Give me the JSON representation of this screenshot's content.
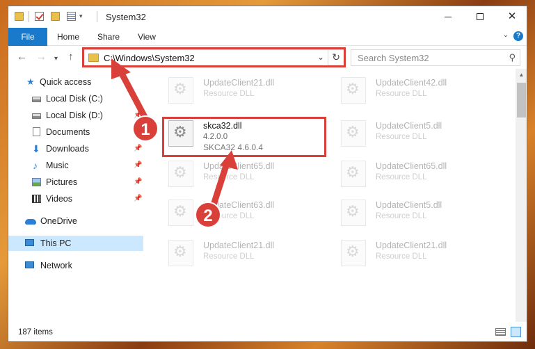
{
  "window": {
    "title": "System32",
    "minimize_glyph": "",
    "maximize_glyph": "",
    "close_glyph": "✕"
  },
  "ribbon": {
    "tabs": [
      {
        "label": "File"
      },
      {
        "label": "Home"
      },
      {
        "label": "Share"
      },
      {
        "label": "View"
      }
    ],
    "help_glyph": "?"
  },
  "navigation": {
    "back_glyph": "←",
    "forward_glyph": "→",
    "recent_glyph": "▾",
    "up_glyph": "↑",
    "address": "C:\\Windows\\System32",
    "address_dropdown_glyph": "⌄",
    "refresh_glyph": "↻",
    "search_placeholder": "Search System32",
    "search_glyph": "⚲"
  },
  "sidebar": {
    "items": [
      {
        "label": "Quick access",
        "icon": "star-icon",
        "pinned": false
      },
      {
        "label": "Local Disk (C:)",
        "icon": "disk-icon",
        "pinned": false
      },
      {
        "label": "Local Disk (D:)",
        "icon": "disk-icon",
        "pinned": true
      },
      {
        "label": "Documents",
        "icon": "documents-icon",
        "pinned": true
      },
      {
        "label": "Downloads",
        "icon": "download-icon",
        "pinned": true
      },
      {
        "label": "Music",
        "icon": "music-icon",
        "pinned": true
      },
      {
        "label": "Pictures",
        "icon": "pictures-icon",
        "pinned": true
      },
      {
        "label": "Videos",
        "icon": "videos-icon",
        "pinned": true
      },
      {
        "label": "OneDrive",
        "icon": "cloud-icon",
        "pinned": false
      },
      {
        "label": "This PC",
        "icon": "computer-icon",
        "pinned": false,
        "selected": true
      },
      {
        "label": "Network",
        "icon": "network-icon",
        "pinned": false
      }
    ],
    "pin_glyph": "📌"
  },
  "files": {
    "left_column": [
      {
        "name": "UpdateClient21.dll",
        "type": "Resource DLL",
        "faded": true
      },
      {
        "name": "skca32.dll",
        "type": "4.2.0.0",
        "extra": "SKCA32 4.6.0.4",
        "faded": false
      },
      {
        "name": "UpdateClient65.dll",
        "type": "Resource DLL",
        "faded": true
      },
      {
        "name": "UpdateClient63.dll",
        "type": "Resource DLL",
        "faded": true
      },
      {
        "name": "UpdateClient21.dll",
        "type": "Resource DLL",
        "faded": true
      }
    ],
    "right_column": [
      {
        "name": "UpdateClient42.dll",
        "type": "Resource DLL",
        "faded": true
      },
      {
        "name": "UpdateClient5.dll",
        "type": "Resource DLL",
        "faded": true
      },
      {
        "name": "UpdateClient65.dll",
        "type": "Resource DLL",
        "faded": true
      },
      {
        "name": "UpdateClient5.dll",
        "type": "Resource DLL",
        "faded": true
      },
      {
        "name": "UpdateClient21.dll",
        "type": "Resource DLL",
        "faded": true
      }
    ]
  },
  "status": {
    "item_count": "187 items"
  },
  "annotations": {
    "step1": "1",
    "step2": "2",
    "color": "#d9403a"
  },
  "colors": {
    "accent": "#1979ca",
    "selection": "#cce8ff",
    "highlight": "#d9403a"
  }
}
